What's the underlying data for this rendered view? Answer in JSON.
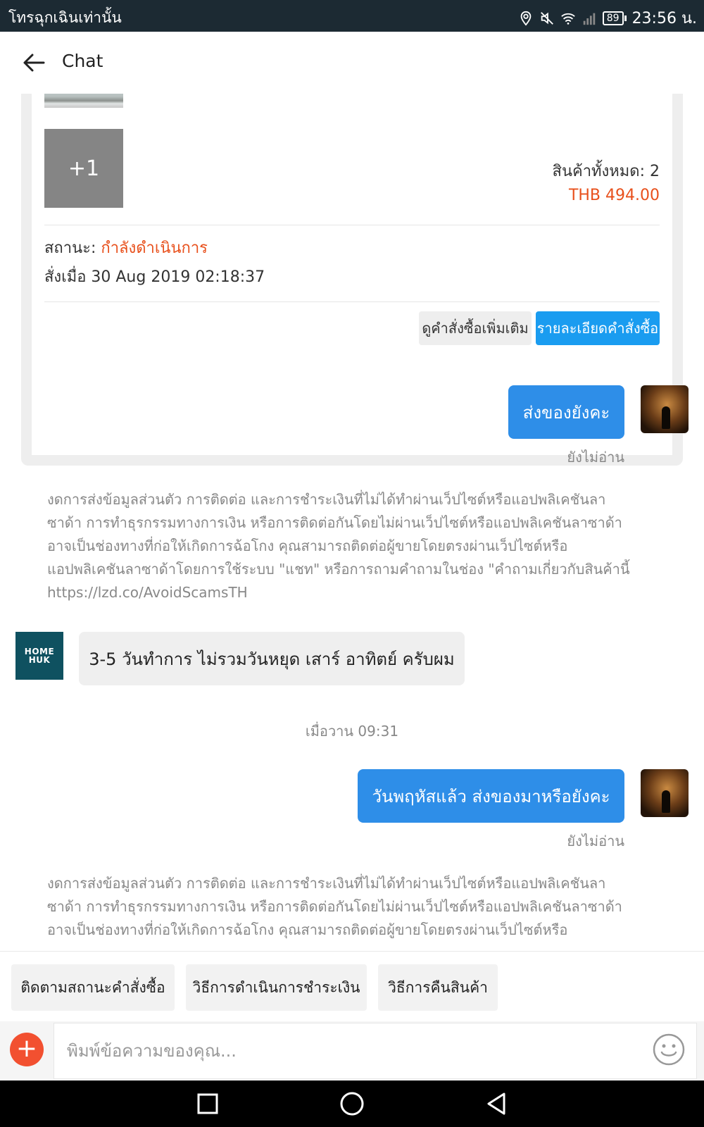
{
  "status_bar": {
    "carrier": "โทรฉุกเฉินเท่านั้น",
    "battery": "89",
    "time": "23:56 น.",
    "icons": [
      "location-icon",
      "mute-icon",
      "wifi-icon",
      "signal-icon"
    ]
  },
  "header": {
    "title": "Chat",
    "back_icon": "arrow-left-icon"
  },
  "order_card": {
    "more_items_badge": "+1",
    "total_items": "สินค้าทั้งหมด: 2",
    "total_price": "THB 494.00",
    "status_label": "สถานะ: ",
    "status_value": "กำลังดำเนินการ",
    "ordered_at": "สั่งเมื่อ 30 Aug 2019  02:18:37",
    "view_more_orders": "ดูคำสั่งซื้อเพิ่มเติม",
    "order_details": "รายละเอียดคำสั่งซื้อ"
  },
  "messages": [
    {
      "type": "outgoing",
      "text": "ส่งของยังคะ",
      "read_status": "ยังไม่อ่าน"
    },
    {
      "type": "system",
      "text": "งดการส่งข้อมูลส่วนตัว การติดต่อ และการชำระเงินที่ไม่ได้ทำผ่านเว็ปไซต์หรือแอปพลิเคชันลาซาด้า การทำธุรกรรมทางการเงิน หรือการติดต่อกันโดยไม่ผ่านเว็ปไซต์หรือแอปพลิเคชันลาซาด้าอาจเป็นช่องทางที่ก่อให้เกิดการฉ้อโกง คุณสามารถติดต่อผู้ขายโดยตรงผ่านเว็ปไซต์หรือแอปพลิเคชันลาซาด้าโดยการใช้ระบบ \"แชท\" หรือการถามคำถามในช่อง \"คำถามเกี่ยวกับสินค้านี้ https://lzd.co/AvoidScamsTH"
    },
    {
      "type": "incoming",
      "text": "3-5 วันทำการ ไม่รวมวันหยุด เสาร์ อาทิตย์ ครับผม",
      "shop_logo": "HOME HUK"
    },
    {
      "type": "time",
      "text": "เมื่อวาน 09:31"
    },
    {
      "type": "outgoing",
      "text": "วันพฤหัสแล้ว ส่งของมาหรือยังคะ",
      "read_status": "ยังไม่อ่าน"
    },
    {
      "type": "system",
      "text": "งดการส่งข้อมูลส่วนตัว การติดต่อ และการชำระเงินที่ไม่ได้ทำผ่านเว็ปไซต์หรือแอปพลิเคชันลาซาด้า การทำธุรกรรมทางการเงิน หรือการติดต่อกันโดยไม่ผ่านเว็ปไซต์หรือแอปพลิเคชันลาซาด้าอาจเป็นช่องทางที่ก่อให้เกิดการฉ้อโกง คุณสามารถติดต่อผู้ขายโดยตรงผ่านเว็ปไซต์หรือ"
    }
  ],
  "quick_replies": [
    "ติดตามสถานะคำสั่งซื้อ",
    "วิธีการดำเนินการชำระเงิน",
    "วิธีการคืนสินค้า"
  ],
  "composer": {
    "placeholder": "พิมพ์ข้อความของคุณ...",
    "plus_icon": "plus-icon",
    "emoji_icon": "smiley-icon"
  },
  "nav_bar": [
    "recents-square-icon",
    "home-circle-icon",
    "back-triangle-icon"
  ],
  "colors": {
    "accent_blue": "#2e8ee8",
    "button_blue": "#1a9cf0",
    "price_orange": "#e8501c",
    "plus_red": "#f25030",
    "status_bar": "#1c2a33",
    "shop_teal": "#0f5160"
  }
}
